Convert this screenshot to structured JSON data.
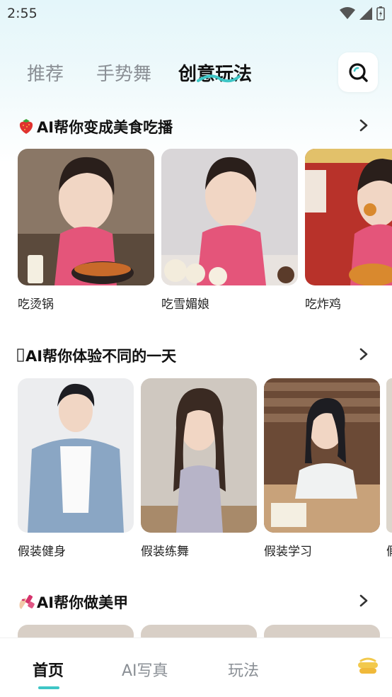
{
  "status_bar": {
    "time": "2:55"
  },
  "top_tabs": [
    {
      "label": "推荐"
    },
    {
      "label": "手势舞"
    },
    {
      "label": "创意玩法"
    }
  ],
  "sections": [
    {
      "title": "AI帮你变成美食吃播",
      "items": [
        {
          "label": "吃烫锅"
        },
        {
          "label": "吃雪媚娘"
        },
        {
          "label": "吃炸鸡"
        }
      ]
    },
    {
      "title": "AI帮你体验不同的一天",
      "items": [
        {
          "label": "假装健身"
        },
        {
          "label": "假装练舞"
        },
        {
          "label": "假装学习"
        },
        {
          "label": "假"
        }
      ]
    },
    {
      "title": "AI帮你做美甲",
      "items": []
    }
  ],
  "bottom_nav": [
    {
      "label": "首页"
    },
    {
      "label": "AI写真"
    },
    {
      "label": "玩法"
    }
  ],
  "colors": {
    "accent": "#3ec6c6",
    "inactive_text": "#8a8f95",
    "header_gradient": "#e4f6fa"
  }
}
